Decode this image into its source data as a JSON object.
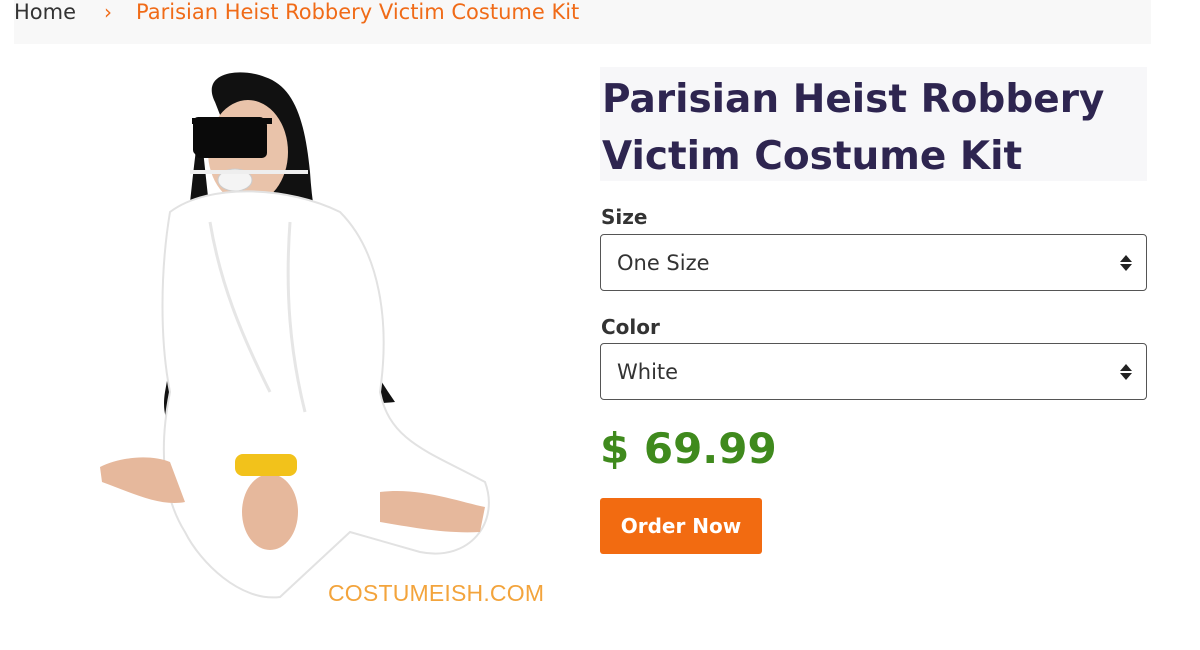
{
  "breadcrumb": {
    "home": "Home",
    "separator": "›",
    "current": "Parisian Heist Robbery Victim Costume Kit"
  },
  "product": {
    "title": "Parisian Heist Robbery Victim Costume Kit",
    "image_watermark": "COSTUMEISH.COM",
    "size_label": "Size",
    "size_value": "One Size",
    "color_label": "Color",
    "color_value": "White",
    "price": "$ 69.99",
    "order_button": "Order Now"
  },
  "colors": {
    "accent": "#f26b11",
    "title": "#2e2550",
    "price": "#3f8a1d"
  },
  "icons": {
    "select_arrows": "up-down-chevron-icon"
  }
}
